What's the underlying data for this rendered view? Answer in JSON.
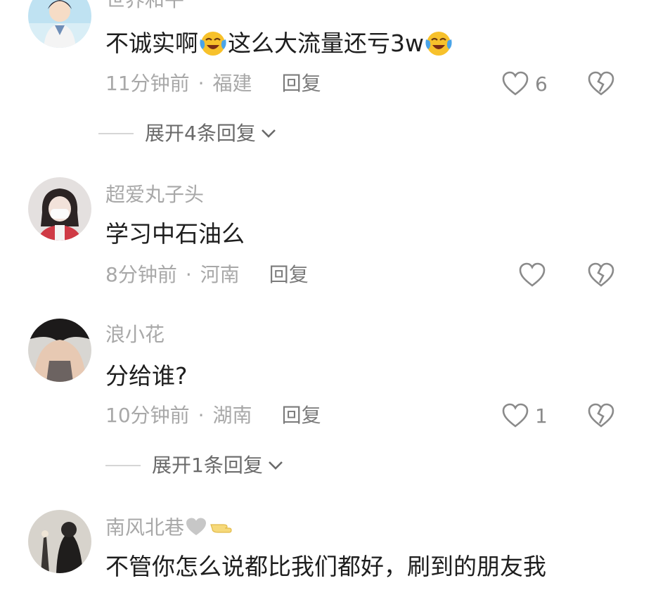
{
  "comments": [
    {
      "username": "世界和平",
      "content_parts": [
        "不诚实啊",
        "这么大流量还亏3w"
      ],
      "time": "11分钟前",
      "location": "福建",
      "reply_label": "回复",
      "like_count": "6",
      "expand_label": "展开4条回复"
    },
    {
      "username": "超爱丸子头",
      "content": "学习中石油么",
      "time": "8分钟前",
      "location": "河南",
      "reply_label": "回复"
    },
    {
      "username": "浪小花",
      "content": "分给谁?",
      "time": "10分钟前",
      "location": "湖南",
      "reply_label": "回复",
      "like_count": "1",
      "expand_label": "展开1条回复"
    },
    {
      "username": "南风北巷",
      "content": "不管你怎么说都比我们都好，刷到的朋友我"
    }
  ],
  "separator": "·",
  "icons": {
    "like": "heart-outline-icon",
    "dislike": "broken-heart-icon",
    "expand": "chevron-down-icon",
    "emoji": "crying-laughing-emoji",
    "username_emoji": [
      "grey-heart-emoji",
      "pointing-hand-emoji"
    ]
  }
}
